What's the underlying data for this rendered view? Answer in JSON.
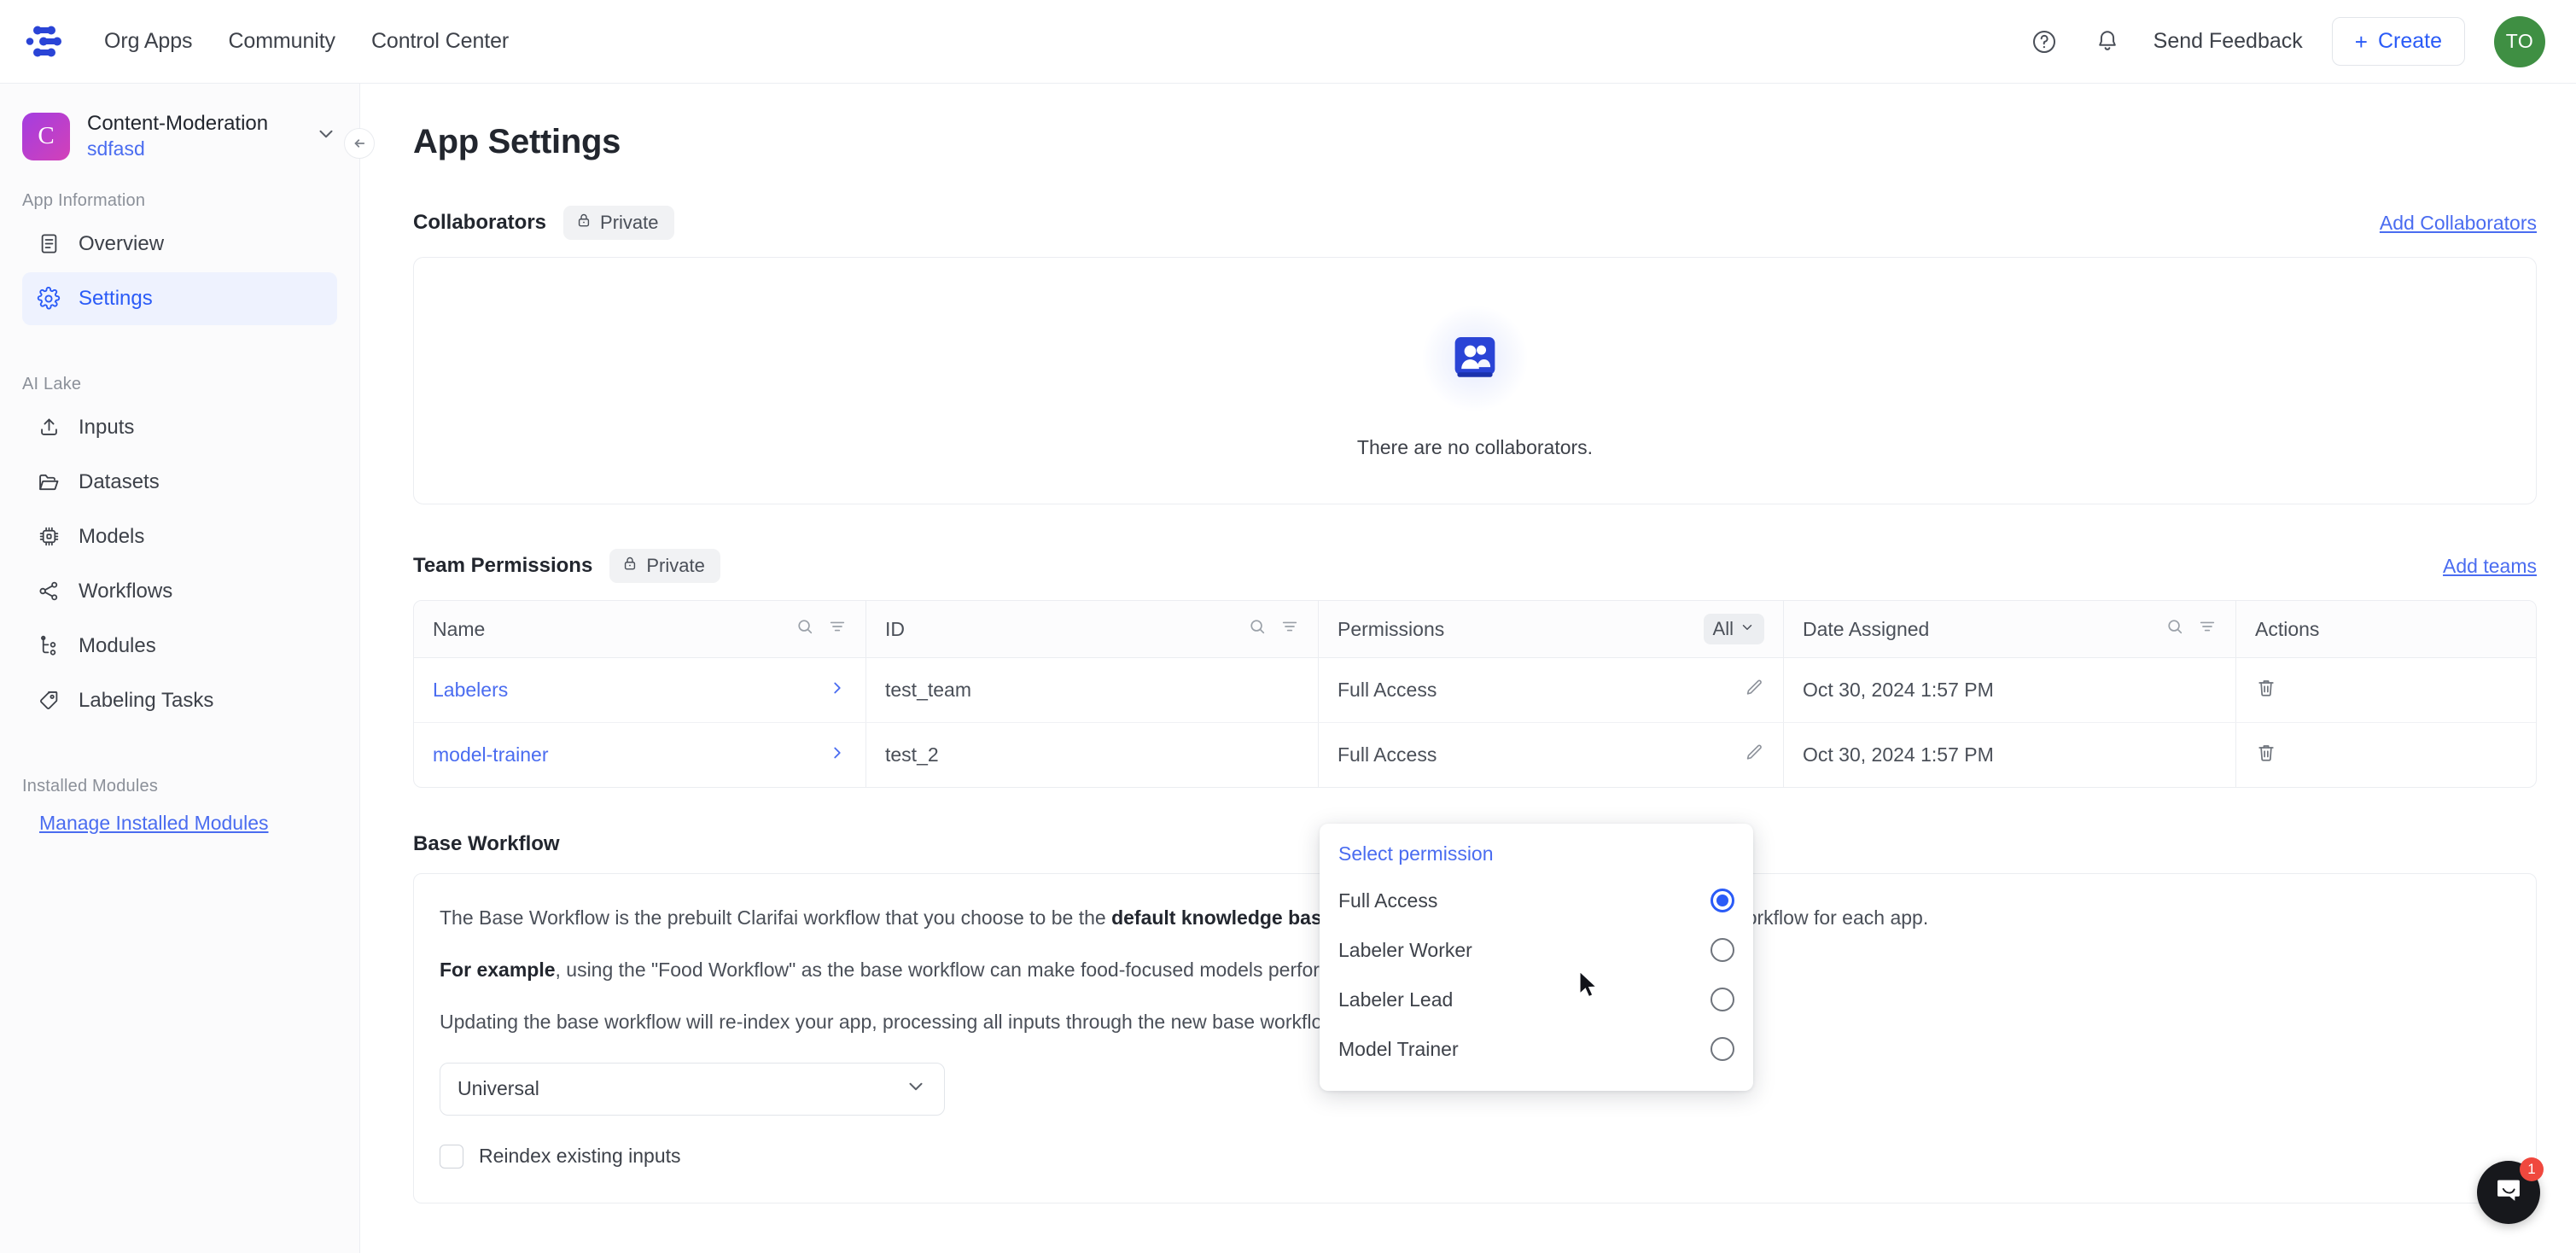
{
  "topbar": {
    "logo_name": "clarifai-logo",
    "nav": [
      {
        "label": "Org Apps"
      },
      {
        "label": "Community"
      },
      {
        "label": "Control Center"
      }
    ],
    "help_icon": "help-circle-icon",
    "bell_icon": "bell-icon",
    "send_feedback": "Send Feedback",
    "create_plus": "+",
    "create_label": "Create",
    "avatar_initials": "TO",
    "avatar_color": "#3f8f43"
  },
  "sidebar": {
    "app": {
      "avatar_letter": "C",
      "name": "Content-Moderation",
      "subtitle": "sdfasd"
    },
    "groups": [
      {
        "label": "App Information",
        "items": [
          {
            "label": "Overview",
            "icon": "document-icon",
            "active": false
          },
          {
            "label": "Settings",
            "icon": "gear-icon",
            "active": true
          }
        ]
      },
      {
        "label": "AI Lake",
        "items": [
          {
            "label": "Inputs",
            "icon": "upload-icon",
            "active": false
          },
          {
            "label": "Datasets",
            "icon": "folder-icon",
            "active": false
          },
          {
            "label": "Models",
            "icon": "chip-icon",
            "active": false
          },
          {
            "label": "Workflows",
            "icon": "share-nodes-icon",
            "active": false
          },
          {
            "label": "Modules",
            "icon": "modules-tree-icon",
            "active": false
          },
          {
            "label": "Labeling Tasks",
            "icon": "tag-icon",
            "active": false
          }
        ]
      },
      {
        "label": "Installed Modules",
        "items": []
      }
    ],
    "manage_modules_link": "Manage Installed Modules"
  },
  "main": {
    "page_title": "App Settings",
    "collaborators": {
      "title": "Collaborators",
      "privacy_badge": "Private",
      "add_link": "Add Collaborators",
      "empty_message": "There are no collaborators."
    },
    "team_permissions": {
      "title": "Team Permissions",
      "privacy_badge": "Private",
      "add_link": "Add teams",
      "columns": [
        {
          "label": "Name",
          "has_search": true,
          "has_filter": true
        },
        {
          "label": "ID",
          "has_search": true,
          "has_filter": true
        },
        {
          "label": "Permissions",
          "filter_value": "All"
        },
        {
          "label": "Date Assigned",
          "has_search": true,
          "has_filter": true
        },
        {
          "label": "Actions"
        }
      ],
      "rows": [
        {
          "name": "Labelers",
          "id": "test_team",
          "permission": "Full Access",
          "date_assigned": "Oct 30, 2024 1:57 PM"
        },
        {
          "name": "model-trainer",
          "id": "test_2",
          "permission": "Full Access",
          "date_assigned": "Oct 30, 2024 1:57 PM"
        }
      ]
    },
    "permission_dropdown": {
      "title": "Select permission",
      "options": [
        {
          "label": "Full Access",
          "selected": true
        },
        {
          "label": "Labeler Worker",
          "selected": false
        },
        {
          "label": "Labeler Lead",
          "selected": false
        },
        {
          "label": "Model Trainer",
          "selected": false
        }
      ]
    },
    "base_workflow": {
      "title": "Base Workflow",
      "p1_a": "The Base Workflow is the prebuilt Clarifai workflow that you choose to be the ",
      "p1_b": "default knowledge base",
      "p1_c": " for your app. You can only choose one Base Workflow for each app.",
      "p2_b": "For example",
      "p2_c": ", using the \"Food Workflow\" as the base workflow can make food-focused models perform better.",
      "p3": "Updating the base workflow will re-index your app, processing all inputs through the new base workflow. This may take some time.",
      "select_value": "Universal",
      "reindex_label": "Reindex existing inputs",
      "reindex_checked": false
    }
  },
  "chat_widget": {
    "icon": "chat-bubble-icon",
    "badge_count": "1",
    "badge_color": "#f0483e"
  },
  "theme": {
    "accent": "#2a5bf7",
    "link": "#4a6cf0",
    "text": "#3d4149",
    "muted": "#8b9099",
    "border": "#ebedf1"
  }
}
